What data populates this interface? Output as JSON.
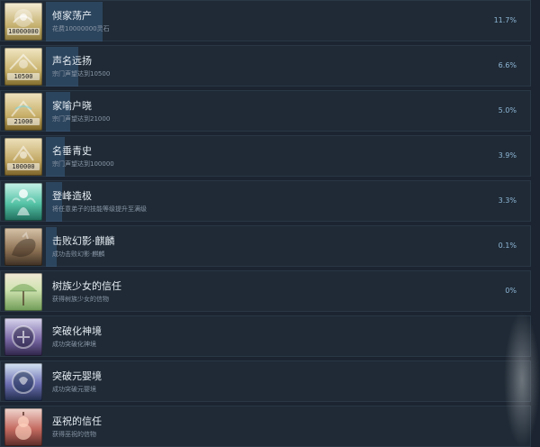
{
  "achievements": [
    {
      "title": "倾家荡产",
      "desc": "花费10000000灵石",
      "pct": "11.7%",
      "progress": 0.117,
      "badge": "10000000",
      "icon": "gold-badge-icon",
      "accent": "#c8b16a"
    },
    {
      "title": "声名远扬",
      "desc": "宗门声望达到10500",
      "pct": "6.6%",
      "progress": 0.066,
      "badge": "10500",
      "icon": "gold-badge-icon",
      "accent": "#c9b36d"
    },
    {
      "title": "家喻户晓",
      "desc": "宗门声望达到21000",
      "pct": "5.0%",
      "progress": 0.05,
      "badge": "21000",
      "icon": "gold-badge-icon",
      "accent": "#c8af69"
    },
    {
      "title": "名垂青史",
      "desc": "宗门声望达到100000",
      "pct": "3.9%",
      "progress": 0.039,
      "badge": "100000",
      "icon": "gold-badge-icon",
      "accent": "#c2a864"
    },
    {
      "title": "登峰造极",
      "desc": "将任意弟子的技能等级提升至满级",
      "pct": "3.3%",
      "progress": 0.033,
      "badge": "",
      "icon": "figure-icon",
      "accent": "#55c3a6"
    },
    {
      "title": "击败幻影·麒麟",
      "desc": "成功击败幻影·麒麟",
      "pct": "0.1%",
      "progress": 0.001,
      "badge": "",
      "icon": "qilin-icon",
      "accent": "#8a6f52"
    },
    {
      "title": "树族少女的信任",
      "desc": "获得树族少女的信物",
      "pct": "0%",
      "progress": 0.0,
      "badge": "",
      "icon": "parasol-icon",
      "accent": "#86b96a"
    },
    {
      "title": "突破化神境",
      "desc": "成功突破化神境",
      "pct": "",
      "progress": 0.0,
      "badge": "",
      "icon": "realm-orb-icon",
      "accent": "#7b6aa7"
    },
    {
      "title": "突破元婴境",
      "desc": "成功突破元婴境",
      "pct": "",
      "progress": 0.0,
      "badge": "",
      "icon": "realm-orb-icon",
      "accent": "#6d6fb2"
    },
    {
      "title": "巫祝的信任",
      "desc": "获得巫祝的信物",
      "pct": "",
      "progress": 0.0,
      "badge": "",
      "icon": "gourd-icon",
      "accent": "#c46a60"
    }
  ]
}
